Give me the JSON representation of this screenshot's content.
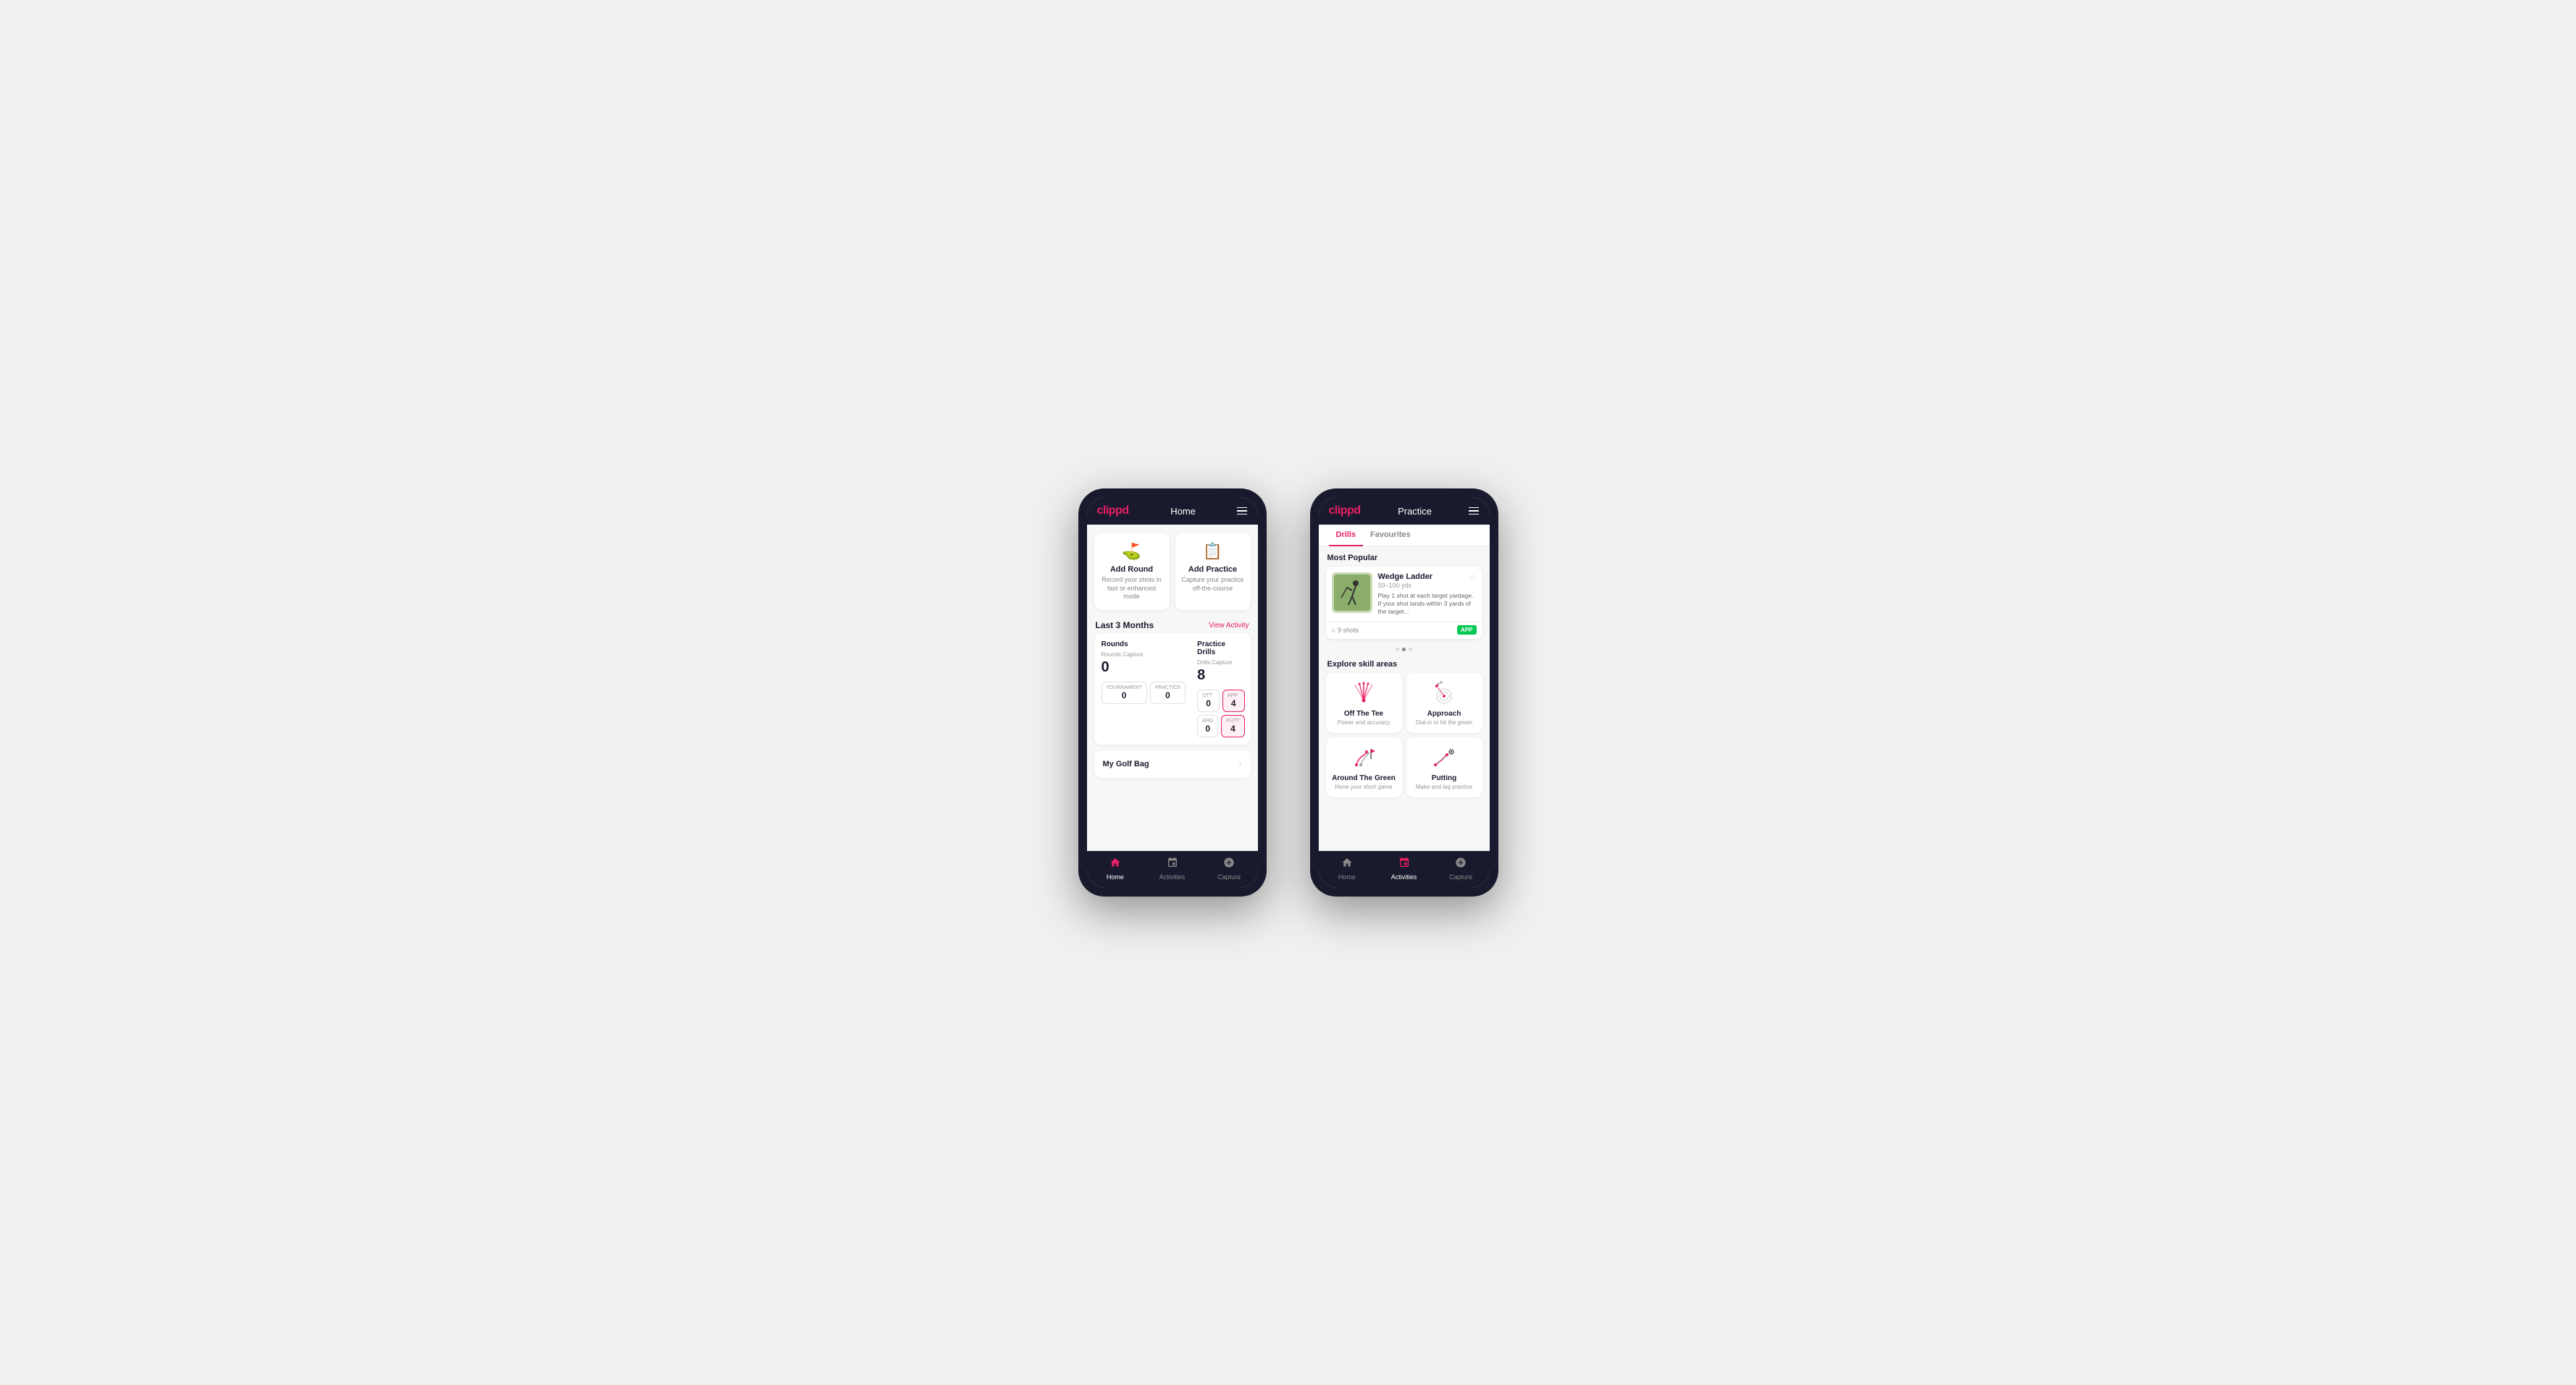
{
  "phone1": {
    "header": {
      "logo": "clippd",
      "title": "Home"
    },
    "actionCards": [
      {
        "icon": "⛳",
        "title": "Add Round",
        "desc": "Record your shots in fast or enhanced mode"
      },
      {
        "icon": "📋",
        "title": "Add Practice",
        "desc": "Capture your practice off-the-course"
      }
    ],
    "stats": {
      "sectionTitle": "Last 3 Months",
      "linkText": "View Activity",
      "rounds": {
        "title": "Rounds",
        "captureLabel": "Rounds Capture",
        "total": "0",
        "tournament": {
          "label": "Tournament",
          "value": "0"
        },
        "practice": {
          "label": "Practice",
          "value": "0"
        }
      },
      "drills": {
        "title": "Practice Drills",
        "captureLabel": "Drills Capture",
        "total": "8",
        "ott": {
          "label": "OTT",
          "value": "0"
        },
        "app": {
          "label": "APP",
          "value": "4"
        },
        "arg": {
          "label": "ARG",
          "value": "0"
        },
        "putt": {
          "label": "PUTT",
          "value": "4"
        }
      }
    },
    "golfBag": {
      "label": "My Golf Bag"
    },
    "bottomNav": [
      {
        "icon": "🏠",
        "label": "Home",
        "active": true
      },
      {
        "icon": "🏌",
        "label": "Activities",
        "active": false
      },
      {
        "icon": "➕",
        "label": "Capture",
        "active": false
      }
    ]
  },
  "phone2": {
    "header": {
      "logo": "clippd",
      "title": "Practice"
    },
    "tabs": [
      {
        "label": "Drills",
        "active": true
      },
      {
        "label": "Favourites",
        "active": false
      }
    ],
    "mostPopular": {
      "sectionLabel": "Most Popular",
      "drill": {
        "name": "Wedge Ladder",
        "range": "50–100 yds",
        "description": "Play 1 shot at each target yardage. If your shot lands within 3 yards of the target...",
        "shots": "9 shots",
        "badge": "APP"
      }
    },
    "exploreSkill": {
      "sectionLabel": "Explore skill areas",
      "skills": [
        {
          "name": "Off The Tee",
          "desc": "Power and accuracy",
          "type": "tee"
        },
        {
          "name": "Approach",
          "desc": "Dial-in to hit the green",
          "type": "approach"
        },
        {
          "name": "Around The Green",
          "desc": "Hone your short game",
          "type": "arg"
        },
        {
          "name": "Putting",
          "desc": "Make and lag practice",
          "type": "putt"
        }
      ]
    },
    "bottomNav": [
      {
        "icon": "🏠",
        "label": "Home",
        "active": false
      },
      {
        "icon": "🏌",
        "label": "Activities",
        "active": true
      },
      {
        "icon": "➕",
        "label": "Capture",
        "active": false
      }
    ]
  }
}
